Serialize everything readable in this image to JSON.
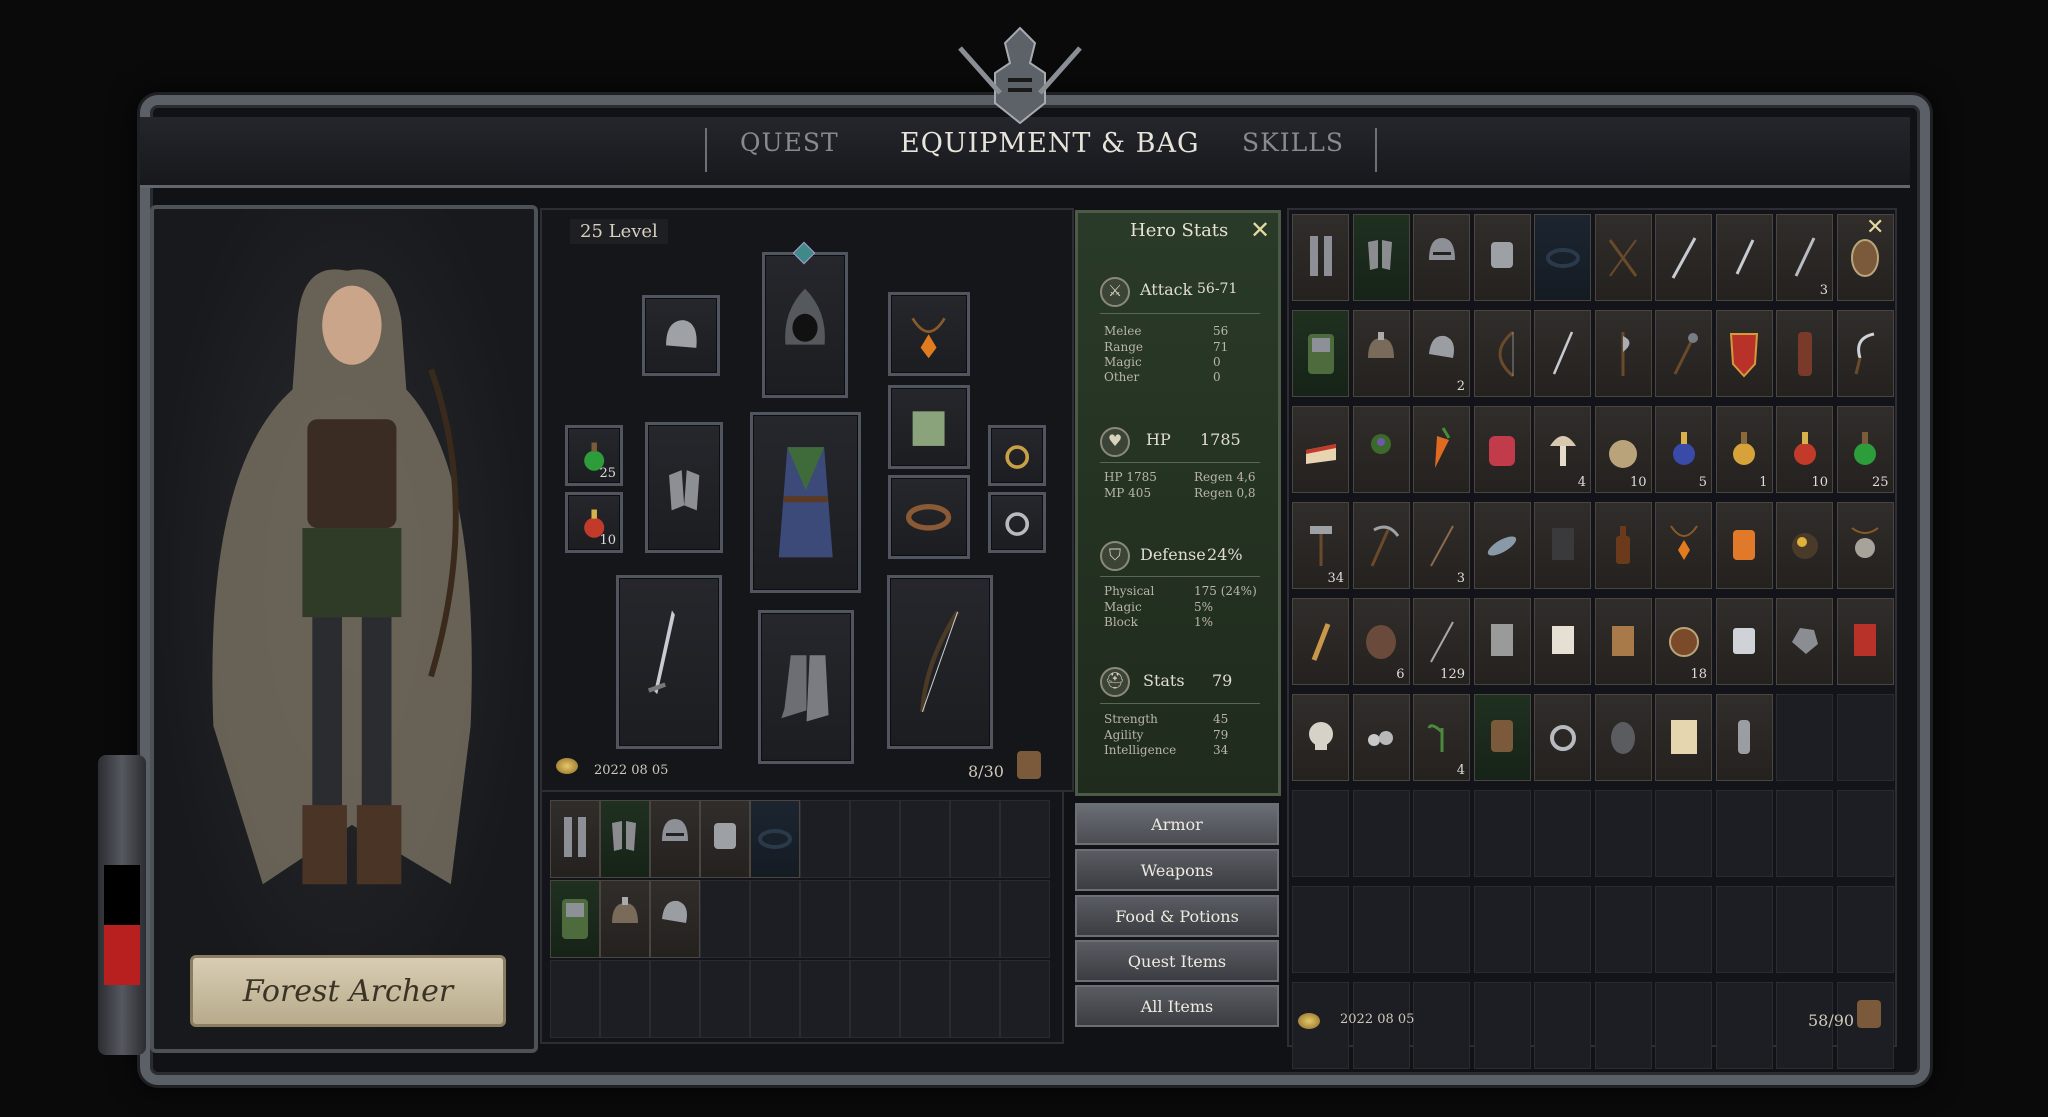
{
  "tabs": {
    "quest": "QUEST",
    "equipment": "EQUIPMENT &  BAG",
    "skills": "SKILLS"
  },
  "character": {
    "name": "Forest Archer",
    "level": "25 Level"
  },
  "equipment": {
    "date": "2022 08 05",
    "count": "8/30",
    "potion_green_qty": "25",
    "potion_red_qty": "10"
  },
  "hero_stats": {
    "title": "Hero Stats",
    "close": "✕",
    "attack": {
      "label": "Attack",
      "value": "56-71",
      "rows": [
        {
          "k": "Melee",
          "v": "56"
        },
        {
          "k": "Range",
          "v": "71"
        },
        {
          "k": "Magic",
          "v": "0"
        },
        {
          "k": "Other",
          "v": "0"
        }
      ]
    },
    "hp": {
      "label": "HP",
      "value": "1785",
      "rows": [
        {
          "k": "HP 1785",
          "v": "Regen 4,6"
        },
        {
          "k": "MP 405",
          "v": "Regen 0,8"
        }
      ]
    },
    "defense": {
      "label": "Defense",
      "value": "24%",
      "rows": [
        {
          "k": "Physical",
          "v": "175 (24%)"
        },
        {
          "k": "Magic",
          "v": "5%"
        },
        {
          "k": "Block",
          "v": "1%"
        }
      ]
    },
    "stats": {
      "label": "Stats",
      "value": "79",
      "rows": [
        {
          "k": "Strength",
          "v": "45"
        },
        {
          "k": "Agility",
          "v": "79"
        },
        {
          "k": "Intelligence",
          "v": "34"
        }
      ]
    }
  },
  "categories": [
    "Armor",
    "Weapons",
    "Food & Potions",
    "Quest Items",
    "All Items"
  ],
  "inventory": {
    "date": "2022 08 05",
    "count": "58/90",
    "rows": [
      [
        "greaves",
        "gauntlets",
        "helmet",
        "bracer",
        "belt",
        "crossbow",
        "sword",
        "dagger",
        "sword2",
        "shield"
      ],
      [
        "chest-armor",
        "spiked-helmet",
        "sallet",
        "bow",
        "sword3",
        "axe",
        "mace",
        "red-shield",
        "quiver",
        "sickle"
      ],
      [
        "cake",
        "herb",
        "carrot",
        "meat",
        "mushroom",
        "sack",
        "potion-blue",
        "potion-gold",
        "potion-red",
        "potion-green"
      ],
      [
        "hammer",
        "pickaxe",
        "arrow",
        "fish",
        "book",
        "bottle",
        "amulet",
        "gem-orange",
        "gold-ore",
        "talisman"
      ],
      [
        "stick",
        "fur",
        "arrow2",
        "tablet",
        "scroll",
        "wood",
        "round-shield",
        "ingot",
        "stone",
        "red-book"
      ],
      [
        "skull",
        "rocks",
        "sprout",
        "backpack",
        "ring",
        "ghoul",
        "map",
        "vial"
      ]
    ],
    "quantities": [
      [
        "",
        "",
        "",
        "",
        "",
        "",
        "",
        "",
        "3",
        ""
      ],
      [
        "",
        "",
        "2",
        "",
        "",
        "",
        "",
        "",
        "",
        ""
      ],
      [
        "",
        "",
        "",
        "",
        "4",
        "10",
        "5",
        "1",
        "10",
        "25"
      ],
      [
        "34",
        "",
        "3",
        "",
        "",
        "",
        "",
        "",
        "",
        ""
      ],
      [
        "",
        "6",
        "129",
        "",
        "",
        "",
        "18",
        "",
        "",
        ""
      ],
      [
        "",
        "",
        "4",
        "",
        "",
        "",
        "",
        ""
      ]
    ]
  },
  "small_bag": [
    "greaves",
    "gauntlets",
    "helmet",
    "bracer",
    "belt",
    "chest-armor",
    "spiked-helmet",
    "sallet"
  ]
}
